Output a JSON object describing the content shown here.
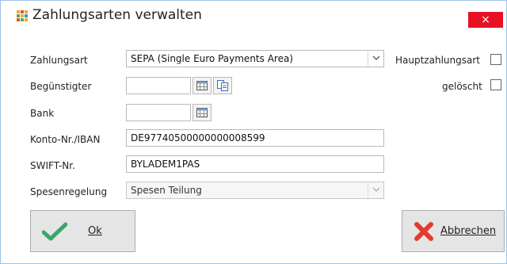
{
  "window": {
    "title": "Zahlungsarten verwalten",
    "close_glyph": "×"
  },
  "form": {
    "zahlungsart_label": "Zahlungsart",
    "zahlungsart_value": "SEPA (Single Euro Payments Area)",
    "beguenstigter_label": "Begünstigter",
    "beguenstigter_value": "",
    "bank_label": "Bank",
    "bank_value": "",
    "konto_label": "Konto-Nr./IBAN",
    "konto_value": "DE97740500000000008599",
    "swift_label": "SWIFT-Nr.",
    "swift_value": "BYLADEM1PAS",
    "spesen_label": "Spesenregelung",
    "spesen_value": "Spesen Teilung",
    "haupt_label": "Hauptzahlungsart",
    "haupt_checked": false,
    "geloescht_label": "gelöscht",
    "geloescht_checked": false
  },
  "buttons": {
    "ok_label": "Ok",
    "cancel_label": "Abbrechen"
  },
  "colors": {
    "accent_border": "#9cc3e6",
    "close_bg": "#e81123",
    "ok_green": "#3aa66a",
    "cancel_red": "#e23b2e"
  },
  "icons": [
    "app-grid-icon",
    "close-icon",
    "chevron-down-icon",
    "calendar-icon",
    "copy-icon",
    "checkmark-icon",
    "x-mark-icon"
  ]
}
